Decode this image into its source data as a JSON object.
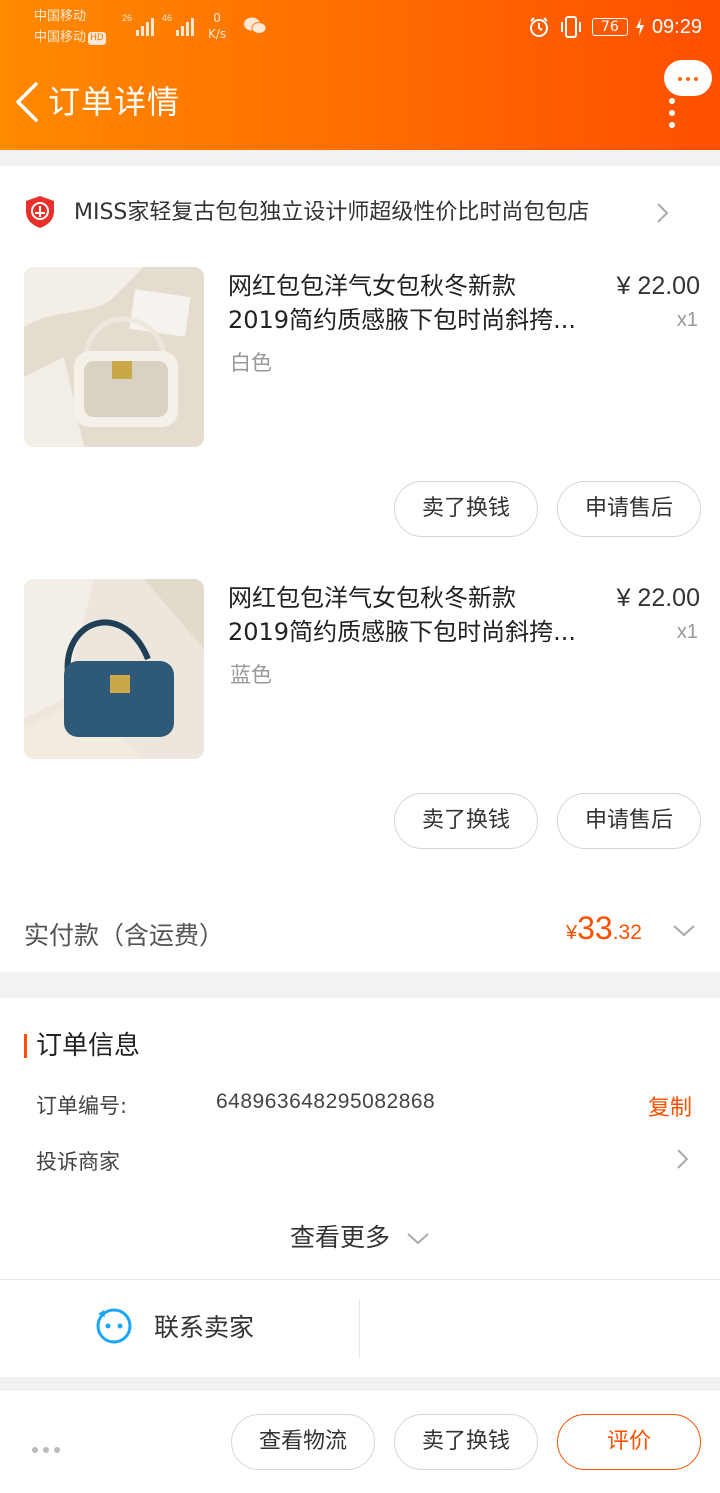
{
  "status_bar": {
    "carrier_1": "中国移动",
    "carrier_2": "中国移动",
    "hd_badge": "HD",
    "signal_1_label": "26",
    "signal_2_label": "46",
    "net_speed_value": "0",
    "net_speed_unit": "K/s",
    "battery": "76",
    "time": "09:29"
  },
  "header": {
    "title": "订单详情"
  },
  "shop": {
    "name": "MISS家轻复古包包独立设计师超级性价比时尚包包店"
  },
  "items": [
    {
      "title_line1": "网红包包洋气女包秋冬新款",
      "title_line2": "2019简约质感腋下包时尚斜挎...",
      "spec": "白色",
      "price": "¥ 22.00",
      "quantity": "x1",
      "button_resell": "卖了换钱",
      "button_after_sale": "申请售后",
      "bag_color": "#d9d2c3"
    },
    {
      "title_line1": "网红包包洋气女包秋冬新款",
      "title_line2": "2019简约质感腋下包时尚斜挎...",
      "spec": "蓝色",
      "price": "¥ 22.00",
      "quantity": "x1",
      "button_resell": "卖了换钱",
      "button_after_sale": "申请售后",
      "bag_color": "#2e5a78"
    }
  ],
  "payment": {
    "label": "实付款（含运费）",
    "currency": "¥",
    "amount_int": "33",
    "amount_dec": ".32"
  },
  "order_info": {
    "section_title": "订单信息",
    "order_no_label": "订单编号:",
    "order_no_value": "648963648295082868",
    "copy_label": "复制",
    "complain_label": "投诉商家",
    "view_more": "查看更多"
  },
  "contact": {
    "label": "联系卖家"
  },
  "bottom_bar": {
    "logistics": "查看物流",
    "resell": "卖了换钱",
    "review": "评价"
  },
  "colors": {
    "brand_orange": "#ff5000",
    "header_gradient_start": "#ff8a00",
    "header_gradient_end": "#ff4f00"
  }
}
